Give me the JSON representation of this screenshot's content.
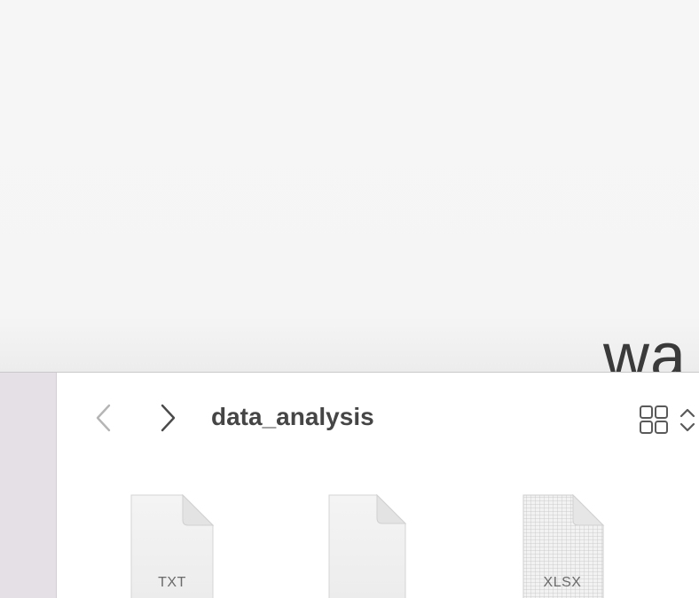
{
  "background_window": {
    "heading_fragment": "wa"
  },
  "finder": {
    "folder_title": "data_analysis",
    "nav": {
      "back_icon": "chevron-left-icon",
      "forward_icon": "chevron-right-icon",
      "back_enabled": false,
      "forward_enabled": true
    },
    "view": {
      "grid_icon": "grid-view-icon",
      "sort_icon": "up-down-chevron-icon"
    },
    "files": [
      {
        "type_label": "TXT",
        "icon": "text-document-icon"
      },
      {
        "type_label": "",
        "icon": "blank-document-icon"
      },
      {
        "type_label": "XLSX",
        "icon": "spreadsheet-document-icon"
      }
    ]
  },
  "colors": {
    "sidebar": "#e5e0e5",
    "title_text": "#454545",
    "icon_stroke": "#5a5a5a",
    "disabled_icon": "#b5b5b5"
  }
}
